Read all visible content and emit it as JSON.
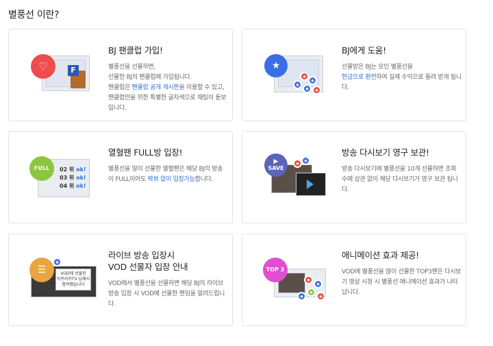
{
  "page": {
    "title": "별풍선 이란?"
  },
  "cards": [
    {
      "title": "BJ 팬클럽 가입!",
      "desc": [
        {
          "t": "별풍선을 선물하면,"
        },
        {
          "t": "선물한 BJ의 팬클럽에 가입됩니다."
        },
        {
          "t": "팬클럽은 "
        },
        {
          "t": "팬클럽 공개 게시판",
          "hl": true
        },
        {
          "t": "을 이용할 수 있고, 팬클럽만을 위한 특별한 글자색으로 채팅이 돋보입니다."
        }
      ]
    },
    {
      "title": "BJ에게 도움!",
      "desc": [
        {
          "t": "선물받은 BJ는 모인 별풍선을"
        },
        {
          "t": "현금으로 환전",
          "hl": true
        },
        {
          "t": "하여 실제 수익으로 돌려 받게 됩니다."
        }
      ]
    },
    {
      "title": "열혈팬 FULL방 입장!",
      "desc": [
        {
          "t": "별풍선을 많이 선물한 열혈팬은 해당 BJ의 방송이 FULL이어도 "
        },
        {
          "t": "꽉뷰 없이 입장가능",
          "hl": true
        },
        {
          "t": "합니다."
        }
      ]
    },
    {
      "title": "방송 다시보기 영구 보관!",
      "desc": [
        {
          "t": "방송 다시보기에 별풍선을 10개 선물하면 조회수에 상관 없이 해당 다시보기가 영구 보관 됩니다."
        }
      ]
    },
    {
      "title": "라이브 방송 입장시\nVOD 선물자 입장 안내",
      "desc": [
        {
          "t": "VOD에서 별풍선을 선물하면 해당 BJ의 라이브 방송 입장 시 VOD에 선물한 팬임을 알려드립니다."
        }
      ]
    },
    {
      "title": "애니메이션 효과 제공!",
      "desc": [
        {
          "t": "VOD에 별풍선을 많이 선물한 TOP3팬은 다시보기 영상 시청 시 별풍선 애니메이션 효과가 나타납니다."
        }
      ]
    }
  ],
  "illustrations": {
    "full_badge": "FULL",
    "save_badge": "SAVE",
    "top3_badge": "TOP 3",
    "fanclub_letter": "F",
    "rank_rows": [
      {
        "rank": "02 위",
        "ok": "ok!"
      },
      {
        "rank": "03 위",
        "ok": "ok!"
      },
      {
        "rank": "04 위",
        "ok": "ok!"
      }
    ],
    "vod_notice": "VOD에 선물한\n아프리카TV 님께서\n참여했습니다"
  },
  "colors": {
    "fanclub_circle": "#ee4b4f",
    "help_circle": "#3b6ee6",
    "full_circle": "#8cc63e",
    "save_circle": "#5b64b8",
    "vod_circle": "#e9a540",
    "top3_circle": "#e04fd2",
    "highlight_text": "#2f6fd6"
  }
}
